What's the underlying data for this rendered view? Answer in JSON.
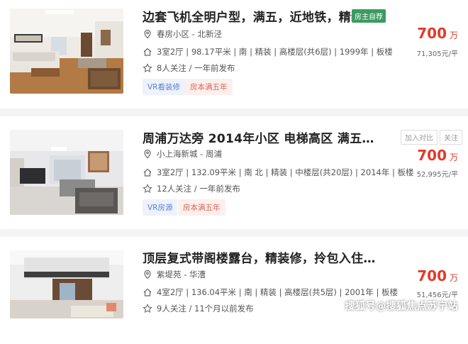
{
  "listings": [
    {
      "title": "边套飞机全明户型，满五，近地铁，精装修",
      "badge": "房主自荐",
      "community": "春房小区 - 北新泾",
      "details": "3室2厅 | 98.17平米 | 南 | 精装 | 高楼层(共6层) | 1999年 | 板楼",
      "followers": "8人关注 / 一年前发布",
      "tags": [
        "VR看装修",
        "房本满五年"
      ],
      "price": "700",
      "price_unit": "万",
      "unit_price": "71,305元/平"
    },
    {
      "title": "周浦万达旁 2014年小区 电梯高区 满五…",
      "community": "小上海新城 - 周浦",
      "details": "3室2厅 | 132.09平米 | 南 北 | 精装 | 中楼层(共20层) | 2014年 | 板楼",
      "followers": "12人关注 / 一年前发布",
      "tags": [
        "VR房源",
        "房本满五年"
      ],
      "price": "700",
      "price_unit": "万",
      "unit_price": "52,995元/平",
      "actions": [
        "加入对比",
        "关注"
      ]
    },
    {
      "title": "顶层复式带阁楼露台，精装修，拎包入住…",
      "community": "紫堤苑 - 华漕",
      "details": "4室2厅 | 136.04平米 | 南 | 精装 | 高楼层(共5层) | 2001年 | 板楼",
      "followers": "9人关注 / 11个月以前发布",
      "price": "700",
      "price_unit": "万",
      "unit_price": "51,456元/平"
    }
  ],
  "watermark": "搜狐号@搜狐焦点苏宁站",
  "colors": {
    "price": "#e4392b",
    "badge": "#3c9a60",
    "vr_tag": "#5a7fd6",
    "owner_tag": "#d6655a"
  }
}
